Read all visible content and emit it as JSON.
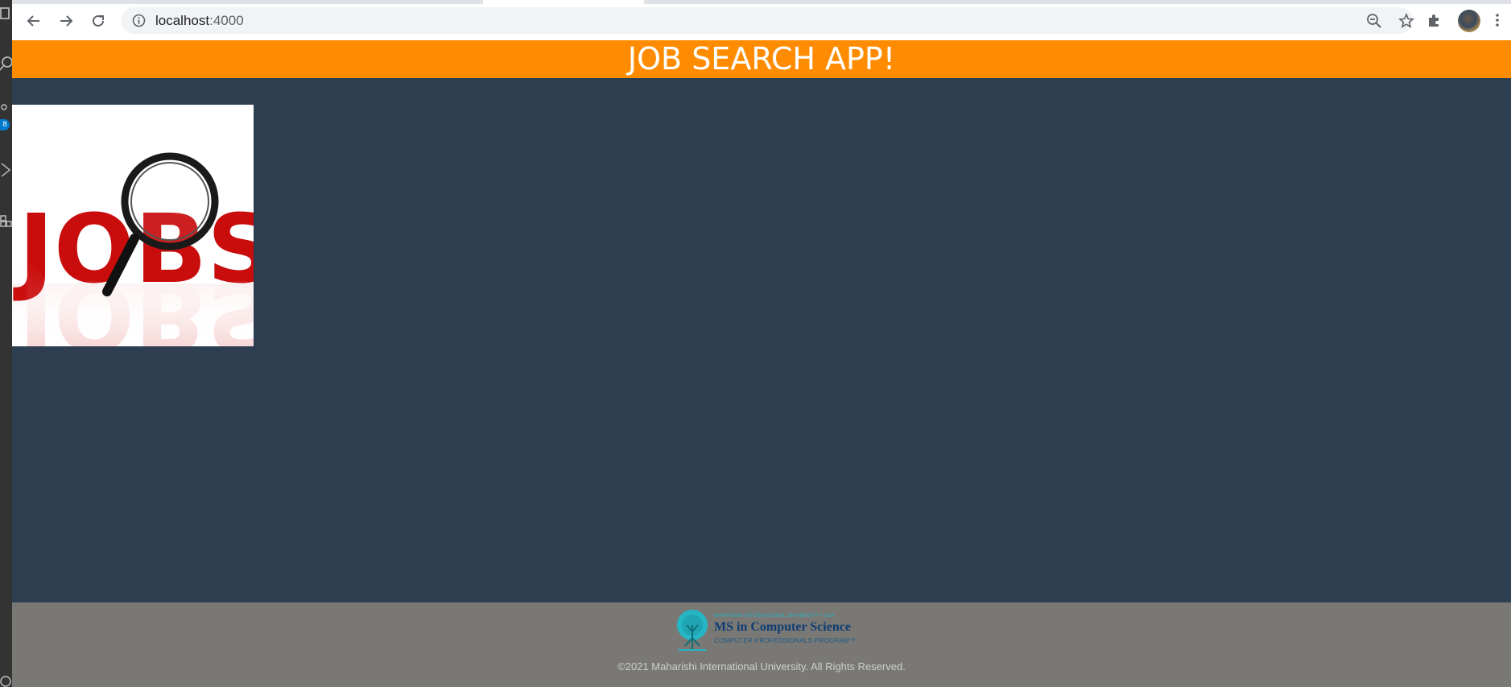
{
  "browser": {
    "url_host": "localhost",
    "url_port": ":4000",
    "icons": [
      "back-arrow-icon",
      "forward-arrow-icon",
      "reload-icon",
      "site-info-icon",
      "zoom-out-icon",
      "bookmark-star-icon",
      "extensions-puzzle-icon",
      "profile-avatar",
      "kebab-menu-icon"
    ]
  },
  "ide": {
    "badge_count": "8"
  },
  "app": {
    "title": "JOB SEARCH APP!",
    "header_color": "#ff8c00",
    "background_color": "#2c3e50",
    "hero_image": {
      "text": "JOBS",
      "letter_color": "#cc0000"
    }
  },
  "footer": {
    "logo_small": "MAHARISHI INTERNATIONAL UNIVERSITY • USA",
    "logo_title": "MS in Computer Science",
    "logo_subtitle": "COMPUTER PROFESSIONALS PROGRAM™",
    "copyright": "©2021 Maharishi International University. All Rights Reserved.",
    "background_color": "#797874"
  }
}
